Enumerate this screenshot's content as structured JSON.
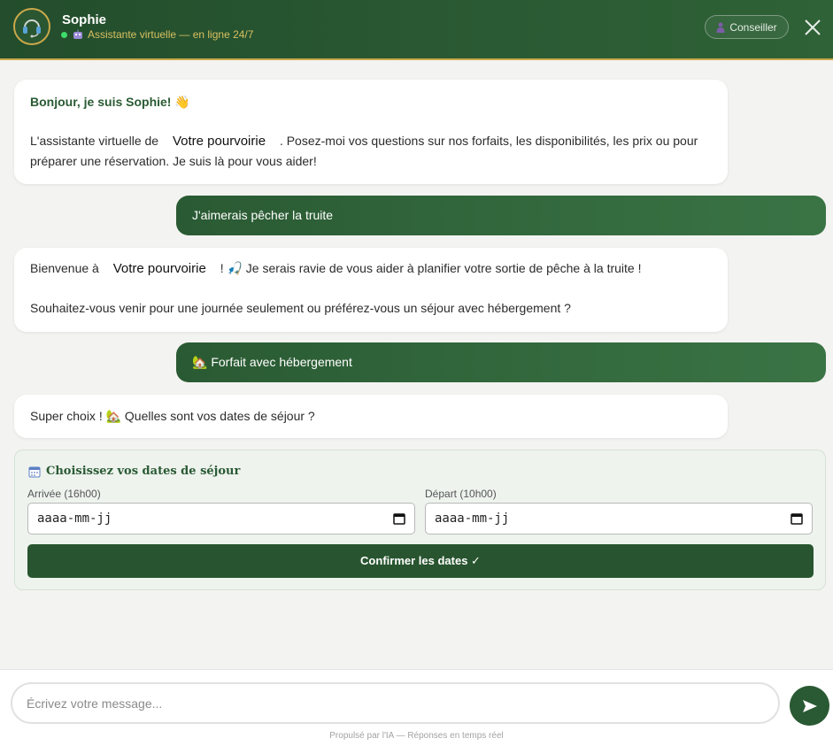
{
  "header": {
    "name": "Sophie",
    "status": "Assistante virtuelle — en ligne 24/7",
    "conseiller_label": "Conseiller",
    "avatar_icon": "headset-icon",
    "colors": {
      "bg": "#234d2c",
      "accent": "#c9a84a",
      "online": "#3ddc6b"
    }
  },
  "messages": [
    {
      "from": "bot",
      "greeting": "Bonjour, je suis Sophie! 👋",
      "intro_before": "L'assistante virtuelle de",
      "brand": "Votre pourvoirie",
      "intro_after": ". Posez-moi vos questions sur nos forfaits, les disponibilités, les prix ou pour",
      "intro_line2": "préparer une réservation. Je suis là pour vous aider!"
    },
    {
      "from": "user",
      "text": "J'aimerais pêcher la truite"
    },
    {
      "from": "bot",
      "welcome_before": "Bienvenue à",
      "brand": "Votre pourvoirie",
      "welcome_after": "! 🎣 Je serais ravie de vous aider à planifier votre sortie de pêche à la truite !",
      "question": "Souhaitez-vous venir pour une journée seulement ou préférez-vous un séjour avec hébergement ?"
    },
    {
      "from": "user",
      "text": "🏡 Forfait avec hébergement"
    },
    {
      "from": "bot",
      "text": "Super choix ! 🏡 Quelles sont vos dates de séjour ?"
    }
  ],
  "date_picker": {
    "title": "Choisissez vos dates de séjour",
    "arrival_label": "Arrivée (16h00)",
    "arrival_value": "aaaa-mm-jj",
    "departure_label": "Départ (10h00)",
    "departure_value": "aaaa-mm-jj",
    "confirm_label": "Confirmer les dates ✓"
  },
  "composer": {
    "placeholder": "Écrivez votre message...",
    "footer": "Propulsé par l'IA — Réponses en temps réel"
  }
}
